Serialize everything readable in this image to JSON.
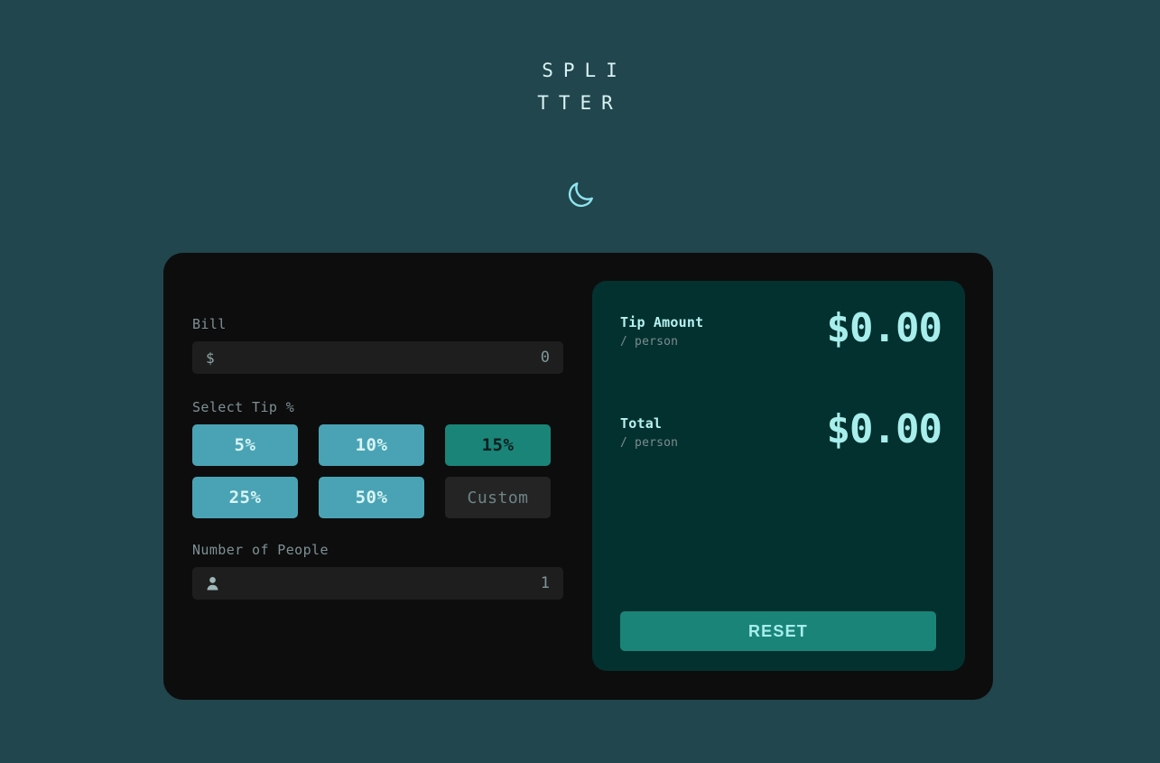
{
  "app": {
    "title": "SPLITTER",
    "theme_toggle_icon": "moon-icon",
    "theme_toggle_label": "Dark mode"
  },
  "colors": {
    "page_background": "#21464d",
    "card_background": "#0d0d0d",
    "results_background": "#03312f",
    "accent_selected": "#1a8478",
    "accent_button": "#4aa3b4",
    "value_text": "#a7eeec",
    "muted_text": "#7e9093"
  },
  "form": {
    "bill": {
      "label": "Bill",
      "icon": "dollar-icon",
      "icon_glyph": "$",
      "value": "0",
      "placeholder": "0"
    },
    "tip": {
      "label": "Select Tip %",
      "selected": "15%",
      "options": [
        {
          "label": "5%",
          "selected": false
        },
        {
          "label": "10%",
          "selected": false
        },
        {
          "label": "15%",
          "selected": true
        },
        {
          "label": "25%",
          "selected": false
        },
        {
          "label": "50%",
          "selected": false
        }
      ],
      "custom": {
        "label": "Custom",
        "placeholder": "Custom",
        "value": ""
      }
    },
    "people": {
      "label": "Number of People",
      "icon": "person-icon",
      "value": "1",
      "placeholder": "1"
    }
  },
  "results": {
    "tip_amount": {
      "title": "Tip Amount",
      "subtitle": "/ person",
      "value": "$0.00"
    },
    "total": {
      "title": "Total",
      "subtitle": "/ person",
      "value": "$0.00"
    },
    "reset_label": "RESET"
  }
}
